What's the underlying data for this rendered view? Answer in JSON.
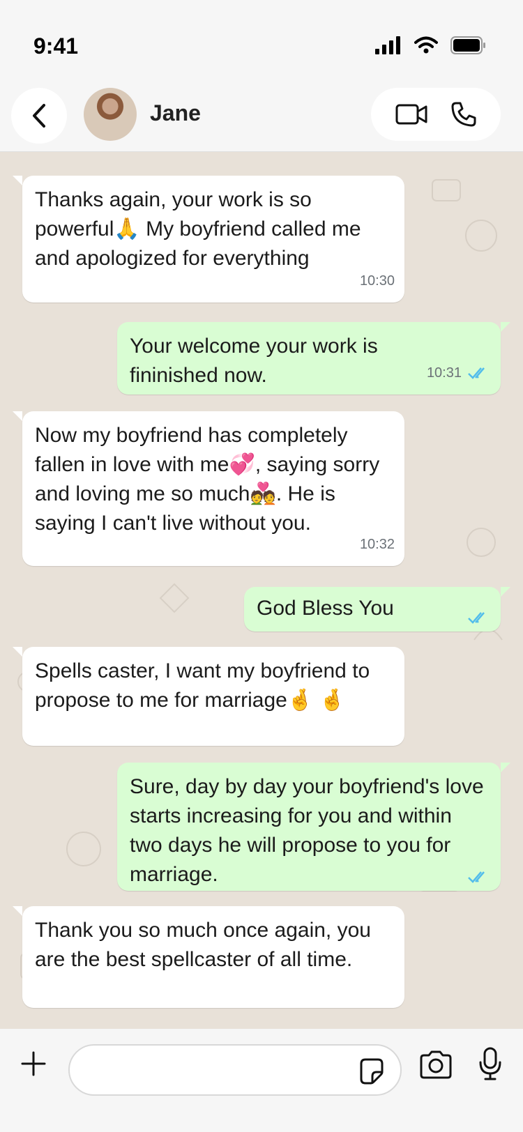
{
  "status_bar": {
    "time": "9:41"
  },
  "header": {
    "contact_name": "Jane"
  },
  "messages": [
    {
      "direction": "in",
      "text": "Thanks again, your work is so powerful🙏 My boyfriend called me and apologized for everything",
      "time": "10:30"
    },
    {
      "direction": "out",
      "text": "Your welcome your work is fininished now.",
      "time": "10:31",
      "read": true
    },
    {
      "direction": "in",
      "text": "Now my boyfriend has completely fallen in love with me💞, saying sorry and loving me so much💑. He is saying I can't live without you.",
      "time": "10:32"
    },
    {
      "direction": "out",
      "text": "God Bless You",
      "time": "",
      "read": true
    },
    {
      "direction": "in",
      "text": "Spells caster, I want my boyfriend to propose to me for marriage🤞 🤞",
      "time": ""
    },
    {
      "direction": "out",
      "text": "Sure, day by day your boyfriend's love starts increasing for you and within two days he will propose to you for marriage.",
      "time": "",
      "read": true
    },
    {
      "direction": "in",
      "text": "Thank you so much once again, you are the best spellcaster of all time.",
      "time": ""
    }
  ],
  "input": {
    "placeholder": ""
  },
  "colors": {
    "incoming": "#ffffff",
    "outgoing": "#d9fdd3",
    "read_ticks": "#53bdeb",
    "background": "#e8e1d8"
  }
}
